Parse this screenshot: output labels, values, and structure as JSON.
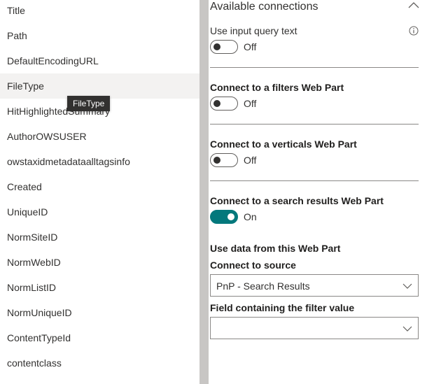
{
  "field_list": {
    "items": [
      "Title",
      "Path",
      "DefaultEncodingURL",
      "FileType",
      "HitHighlightedSummary",
      "AuthorOWSUSER",
      "owstaxidmetadataalltagsinfo",
      "Created",
      "UniqueID",
      "NormSiteID",
      "NormWebID",
      "NormListID",
      "NormUniqueID",
      "ContentTypeId",
      "contentclass"
    ],
    "hovered_index": 3,
    "tooltip": "FileType"
  },
  "connections": {
    "header": "Available connections",
    "header_icon": "chevron-up-icon",
    "input_query": {
      "label": "Use input query text",
      "icon": "info-icon",
      "state": "Off"
    },
    "filters": {
      "label": "Connect to a filters Web Part",
      "state": "Off"
    },
    "verticals": {
      "label": "Connect to a verticals Web Part",
      "state": "Off"
    },
    "search_results": {
      "label": "Connect to a search results Web Part",
      "state": "On"
    },
    "use_data_label": "Use data from this Web Part",
    "source": {
      "label": "Connect to source",
      "value": "PnP - Search Results"
    },
    "filter_field": {
      "label": "Field containing the filter value",
      "value": ""
    }
  },
  "colors": {
    "toggle_on": "#03787c",
    "divider": "#c8c6c4",
    "hover_row": "#f3f2f1"
  }
}
